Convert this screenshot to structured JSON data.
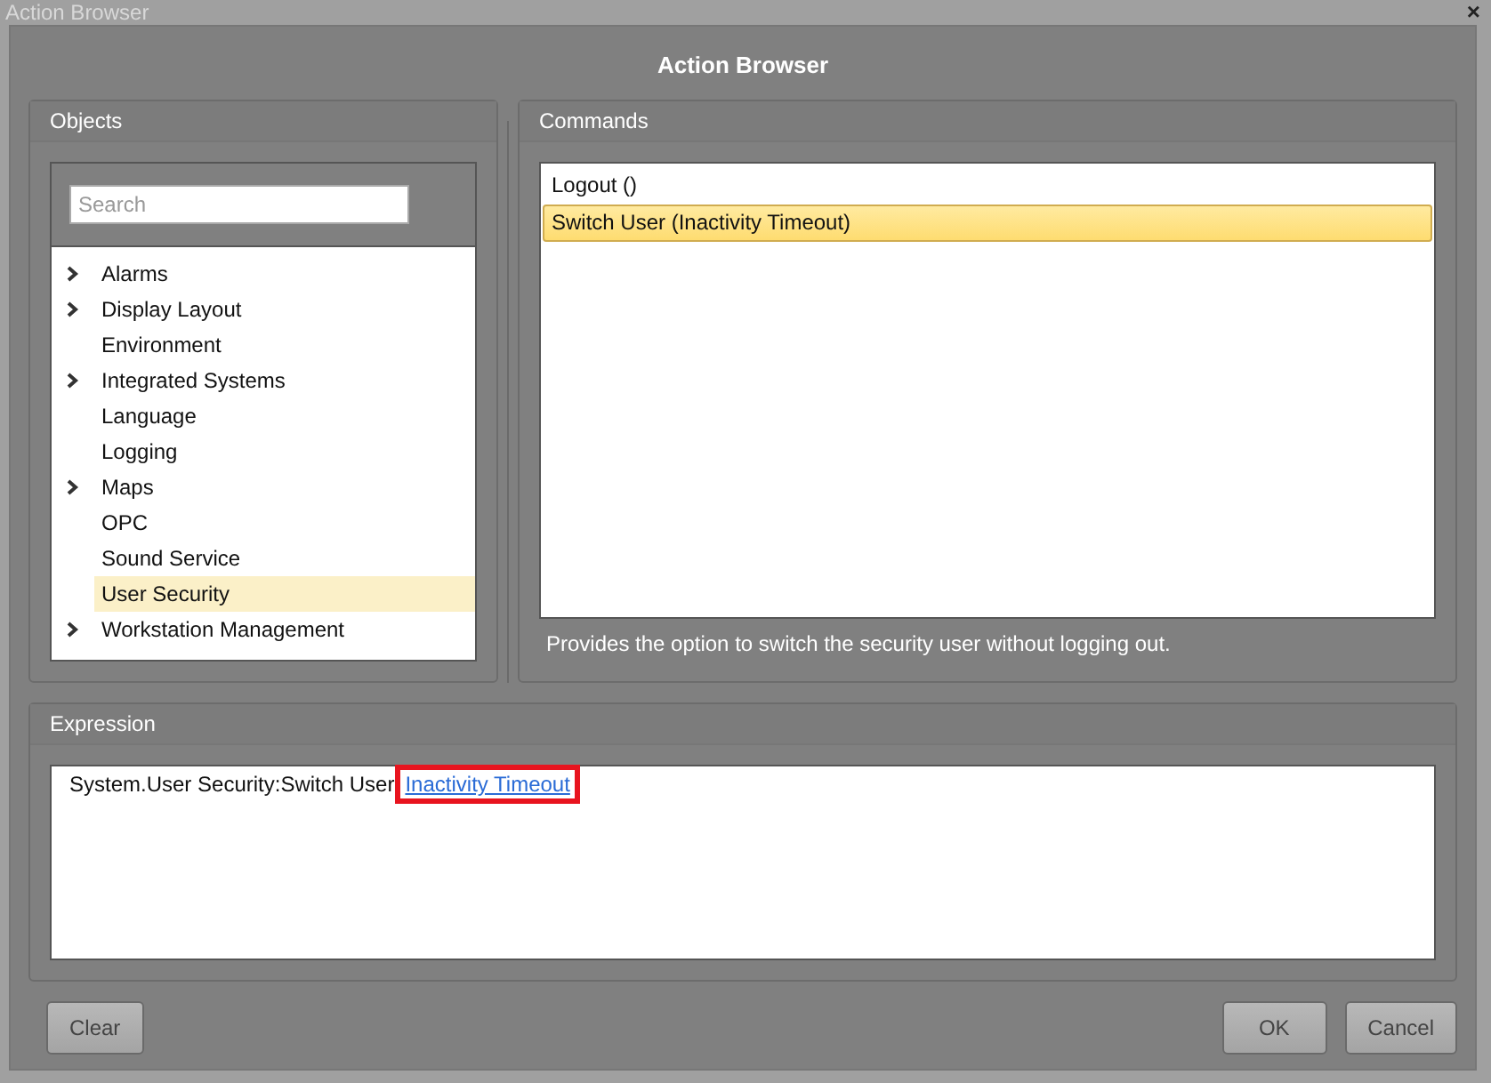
{
  "window": {
    "title": "Action Browser",
    "close": "×"
  },
  "heading": "Action Browser",
  "objects": {
    "title": "Objects",
    "search": {
      "placeholder": "Search"
    },
    "items": [
      {
        "label": "Alarms",
        "expandable": true,
        "selected": false
      },
      {
        "label": "Display Layout",
        "expandable": true,
        "selected": false
      },
      {
        "label": "Environment",
        "expandable": false,
        "selected": false
      },
      {
        "label": "Integrated Systems",
        "expandable": true,
        "selected": false
      },
      {
        "label": "Language",
        "expandable": false,
        "selected": false
      },
      {
        "label": "Logging",
        "expandable": false,
        "selected": false
      },
      {
        "label": "Maps",
        "expandable": true,
        "selected": false
      },
      {
        "label": "OPC",
        "expandable": false,
        "selected": false
      },
      {
        "label": "Sound Service",
        "expandable": false,
        "selected": false
      },
      {
        "label": "User Security",
        "expandable": false,
        "selected": true
      },
      {
        "label": "Workstation Management",
        "expandable": true,
        "selected": false
      }
    ]
  },
  "commands": {
    "title": "Commands",
    "items": [
      {
        "label": "Logout ()",
        "selected": false
      },
      {
        "label": "Switch User (Inactivity Timeout)",
        "selected": true
      }
    ],
    "description": "Provides the option to switch the security user without logging out."
  },
  "expression": {
    "title": "Expression",
    "text": "System.User Security:Switch User",
    "link": "Inactivity Timeout",
    "link_highlighted": true
  },
  "buttons": [
    {
      "label": "Clear",
      "kind": "left"
    },
    {
      "label": "OK",
      "kind": "right"
    },
    {
      "label": "Cancel",
      "kind": "right"
    }
  ]
}
